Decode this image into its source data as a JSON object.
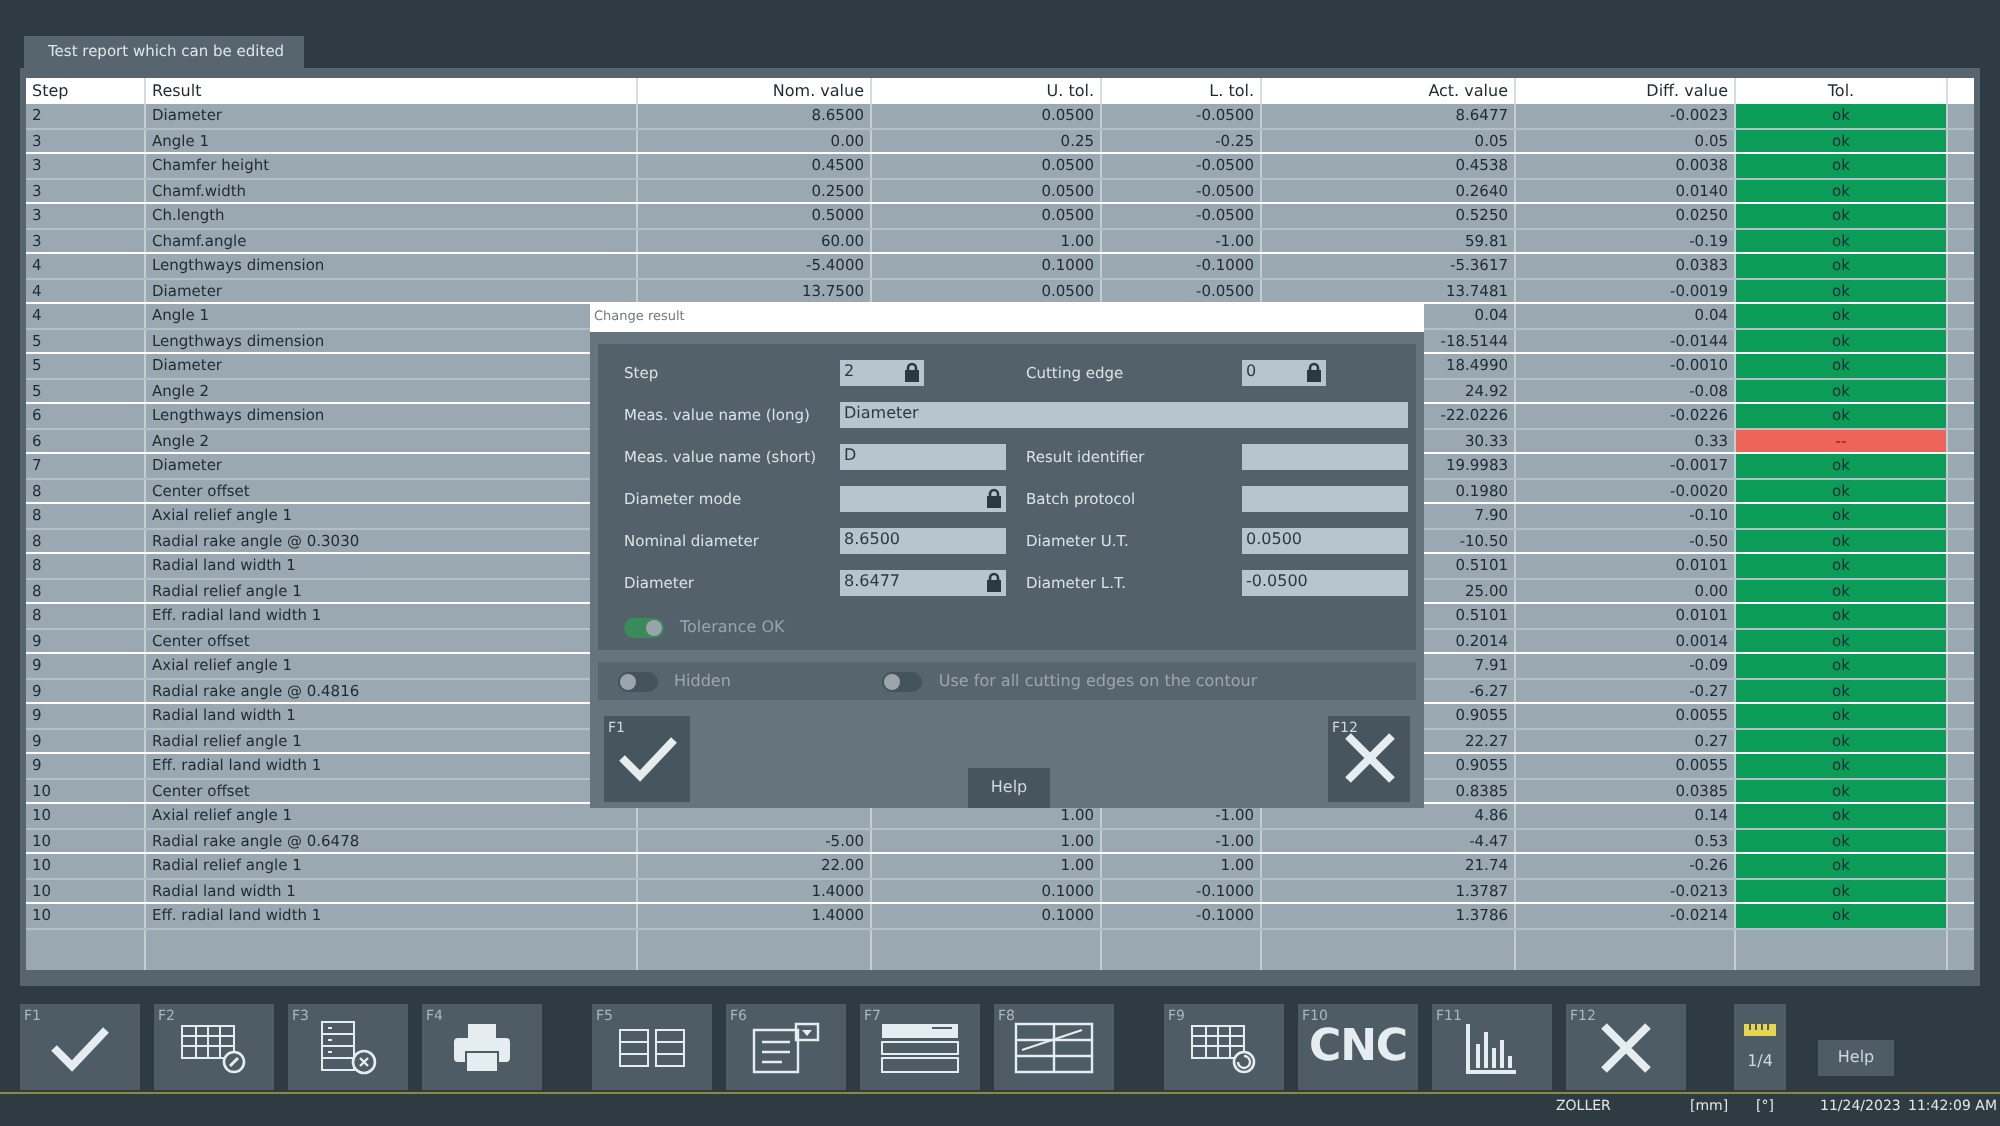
{
  "tab": {
    "label": "Test report which can be edited",
    "selected": true
  },
  "table": {
    "columns": [
      "Step",
      "Result",
      "Nom. value",
      "U. tol.",
      "L. tol.",
      "Act. value",
      "Diff. value",
      "Tol."
    ],
    "rows": [
      {
        "step": "2",
        "result": "Diameter",
        "nom": "8.6500",
        "utol": "0.0500",
        "ltol": "-0.0500",
        "act": "8.6477",
        "diff": "-0.0023",
        "tol": "ok",
        "in_tolerance": true
      },
      {
        "step": "3",
        "result": "Angle 1",
        "nom": "0.00",
        "utol": "0.25",
        "ltol": "-0.25",
        "act": "0.05",
        "diff": "0.05",
        "tol": "ok",
        "in_tolerance": true
      },
      {
        "step": "3",
        "result": "Chamfer height",
        "nom": "0.4500",
        "utol": "0.0500",
        "ltol": "-0.0500",
        "act": "0.4538",
        "diff": "0.0038",
        "tol": "ok",
        "in_tolerance": true
      },
      {
        "step": "3",
        "result": "Chamf.width",
        "nom": "0.2500",
        "utol": "0.0500",
        "ltol": "-0.0500",
        "act": "0.2640",
        "diff": "0.0140",
        "tol": "ok",
        "in_tolerance": true
      },
      {
        "step": "3",
        "result": "Ch.length",
        "nom": "0.5000",
        "utol": "0.0500",
        "ltol": "-0.0500",
        "act": "0.5250",
        "diff": "0.0250",
        "tol": "ok",
        "in_tolerance": true
      },
      {
        "step": "3",
        "result": "Chamf.angle",
        "nom": "60.00",
        "utol": "1.00",
        "ltol": "-1.00",
        "act": "59.81",
        "diff": "-0.19",
        "tol": "ok",
        "in_tolerance": true
      },
      {
        "step": "4",
        "result": "Lengthways dimension",
        "nom": "-5.4000",
        "utol": "0.1000",
        "ltol": "-0.1000",
        "act": "-5.3617",
        "diff": "0.0383",
        "tol": "ok",
        "in_tolerance": true
      },
      {
        "step": "4",
        "result": "Diameter",
        "nom": "13.7500",
        "utol": "0.0500",
        "ltol": "-0.0500",
        "act": "13.7481",
        "diff": "-0.0019",
        "tol": "ok",
        "in_tolerance": true
      },
      {
        "step": "4",
        "result": "Angle 1",
        "act": "0.04",
        "diff": "0.04",
        "tol": "ok",
        "in_tolerance": true
      },
      {
        "step": "5",
        "result": "Lengthways dimension",
        "act": "-18.5144",
        "diff": "-0.0144",
        "tol": "ok",
        "in_tolerance": true
      },
      {
        "step": "5",
        "result": "Diameter",
        "act": "18.4990",
        "diff": "-0.0010",
        "tol": "ok",
        "in_tolerance": true
      },
      {
        "step": "5",
        "result": "Angle 2",
        "act": "24.92",
        "diff": "-0.08",
        "tol": "ok",
        "in_tolerance": true
      },
      {
        "step": "6",
        "result": "Lengthways dimension",
        "act": "-22.0226",
        "diff": "-0.0226",
        "tol": "ok",
        "in_tolerance": true
      },
      {
        "step": "6",
        "result": "Angle 2",
        "act": "30.33",
        "diff": "0.33",
        "tol": "--",
        "in_tolerance": false
      },
      {
        "step": "7",
        "result": "Diameter",
        "act": "19.9983",
        "diff": "-0.0017",
        "tol": "ok",
        "in_tolerance": true
      },
      {
        "step": "8",
        "result": "Center offset",
        "act": "0.1980",
        "diff": "-0.0020",
        "tol": "ok",
        "in_tolerance": true
      },
      {
        "step": "8",
        "result": "Axial relief angle 1",
        "act": "7.90",
        "diff": "-0.10",
        "tol": "ok",
        "in_tolerance": true
      },
      {
        "step": "8",
        "result": "Radial rake angle @ 0.3030",
        "act": "-10.50",
        "diff": "-0.50",
        "tol": "ok",
        "in_tolerance": true
      },
      {
        "step": "8",
        "result": "Radial land width 1",
        "act": "0.5101",
        "diff": "0.0101",
        "tol": "ok",
        "in_tolerance": true
      },
      {
        "step": "8",
        "result": "Radial relief angle 1",
        "act": "25.00",
        "diff": "0.00",
        "tol": "ok",
        "in_tolerance": true
      },
      {
        "step": "8",
        "result": "Eff. radial land width 1",
        "act": "0.5101",
        "diff": "0.0101",
        "tol": "ok",
        "in_tolerance": true
      },
      {
        "step": "9",
        "result": "Center offset",
        "act": "0.2014",
        "diff": "0.0014",
        "tol": "ok",
        "in_tolerance": true
      },
      {
        "step": "9",
        "result": "Axial relief angle 1",
        "act": "7.91",
        "diff": "-0.09",
        "tol": "ok",
        "in_tolerance": true
      },
      {
        "step": "9",
        "result": "Radial rake angle @ 0.4816",
        "act": "-6.27",
        "diff": "-0.27",
        "tol": "ok",
        "in_tolerance": true
      },
      {
        "step": "9",
        "result": "Radial land width 1",
        "act": "0.9055",
        "diff": "0.0055",
        "tol": "ok",
        "in_tolerance": true
      },
      {
        "step": "9",
        "result": "Radial relief angle 1",
        "act": "22.27",
        "diff": "0.27",
        "tol": "ok",
        "in_tolerance": true
      },
      {
        "step": "9",
        "result": "Eff. radial land width 1",
        "act": "0.9055",
        "diff": "0.0055",
        "tol": "ok",
        "in_tolerance": true
      },
      {
        "step": "10",
        "result": "Center offset",
        "act": "0.8385",
        "diff": "0.0385",
        "tol": "ok",
        "in_tolerance": true
      },
      {
        "step": "10",
        "result": "Axial relief angle 1",
        "utol": "1.00",
        "ltol": "-1.00",
        "act": "4.86",
        "diff": "0.14",
        "tol": "ok",
        "in_tolerance": true
      },
      {
        "step": "10",
        "result": "Radial rake angle @ 0.6478",
        "nom": "-5.00",
        "utol": "1.00",
        "ltol": "-1.00",
        "act": "-4.47",
        "diff": "0.53",
        "tol": "ok",
        "in_tolerance": true
      },
      {
        "step": "10",
        "result": "Radial relief angle 1",
        "nom": "22.00",
        "utol": "1.00",
        "ltol": "1.00",
        "act": "21.74",
        "diff": "-0.26",
        "tol": "ok",
        "in_tolerance": true
      },
      {
        "step": "10",
        "result": "Radial land width 1",
        "nom": "1.4000",
        "utol": "0.1000",
        "ltol": "-0.1000",
        "act": "1.3787",
        "diff": "-0.0213",
        "tol": "ok",
        "in_tolerance": true
      },
      {
        "step": "10",
        "result": "Eff. radial land width 1",
        "nom": "1.4000",
        "utol": "0.1000",
        "ltol": "-0.1000",
        "act": "1.3786",
        "diff": "-0.0214",
        "tol": "ok",
        "in_tolerance": true
      }
    ]
  },
  "dialog": {
    "title": "Change result",
    "fields": [
      {
        "label": "Step",
        "value": "2",
        "locked": true,
        "kind": "short"
      },
      {
        "label": "Cutting edge",
        "value": "0",
        "locked": true,
        "kind": "short"
      },
      {
        "label": "Meas. value name (long)",
        "value": "Diameter",
        "locked": false,
        "kind": "full"
      },
      {
        "label": "Meas. value name (short)",
        "value": "D",
        "locked": false,
        "kind": "normal"
      },
      {
        "label": "Result identifier",
        "locked": false,
        "kind": "normal"
      },
      {
        "label": "Diameter mode",
        "locked": true,
        "kind": "normal"
      },
      {
        "label": "Batch protocol",
        "locked": false,
        "kind": "normal"
      },
      {
        "label": "Nominal diameter",
        "value": "8.6500",
        "locked": false,
        "kind": "normal"
      },
      {
        "label": "Diameter U.T.",
        "value": "0.0500",
        "locked": false,
        "kind": "normal"
      },
      {
        "label": "Diameter",
        "value": "8.6477",
        "locked": true,
        "kind": "normal"
      },
      {
        "label": "Diameter L.T.",
        "value": "-0.0500",
        "locked": false,
        "kind": "normal"
      }
    ],
    "tolerance_toggle": {
      "label": "Tolerance OK",
      "on": true
    },
    "toggles": [
      {
        "label": "Hidden",
        "on": false
      },
      {
        "label": "Use for all cutting edges on the contour",
        "on": false
      }
    ],
    "ok_key": "F1",
    "cancel_key": "F12",
    "help": "Help"
  },
  "toolbar": [
    {
      "key": "F1",
      "kind": "check"
    },
    {
      "key": "F2",
      "kind": "table-edit"
    },
    {
      "key": "F3",
      "kind": "list-delete"
    },
    {
      "key": "F4",
      "kind": "printer"
    },
    {
      "key": "F5",
      "kind": "columns"
    },
    {
      "key": "F6",
      "kind": "form"
    },
    {
      "key": "F7",
      "kind": "rows"
    },
    {
      "key": "F8",
      "kind": "sheet"
    },
    {
      "key": "F9",
      "kind": "table-refresh"
    },
    {
      "key": "F10",
      "kind": "text",
      "text": "CNC"
    },
    {
      "key": "F11",
      "kind": "chart"
    },
    {
      "key": "F12",
      "kind": "close"
    }
  ],
  "page_indicator": "1/4",
  "help": "Help",
  "status_bar": [
    "ZOLLER",
    "[mm]",
    "[°]",
    "11/24/2023",
    "11:42:09 AM"
  ]
}
